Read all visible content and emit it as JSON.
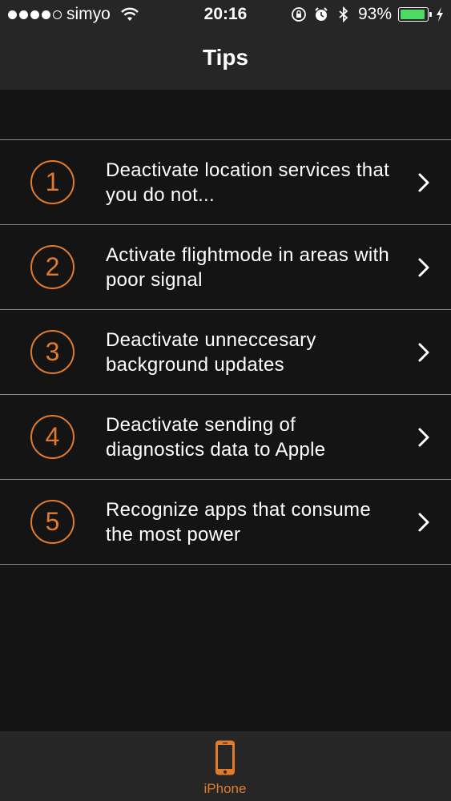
{
  "status_bar": {
    "carrier": "simyo",
    "time": "20:16",
    "battery_percent": "93%",
    "battery_level": 0.93,
    "signal_bars_filled": 4,
    "signal_bars_total": 5
  },
  "header": {
    "title": "Tips"
  },
  "tips": [
    {
      "number": "1",
      "text": "Deactivate location services that you do not..."
    },
    {
      "number": "2",
      "text": "Activate flightmode in areas with poor signal"
    },
    {
      "number": "3",
      "text": "Deactivate unneccesary background updates"
    },
    {
      "number": "4",
      "text": "Deactivate sending of diagnostics data to Apple"
    },
    {
      "number": "5",
      "text": "Recognize apps that consume the most power"
    }
  ],
  "tab_bar": {
    "items": [
      {
        "label": "iPhone",
        "icon": "iphone-icon",
        "selected": true
      }
    ]
  },
  "colors": {
    "accent": "#e07b2c",
    "background": "#141414",
    "bar_background": "#262626",
    "battery": "#4cd964"
  }
}
